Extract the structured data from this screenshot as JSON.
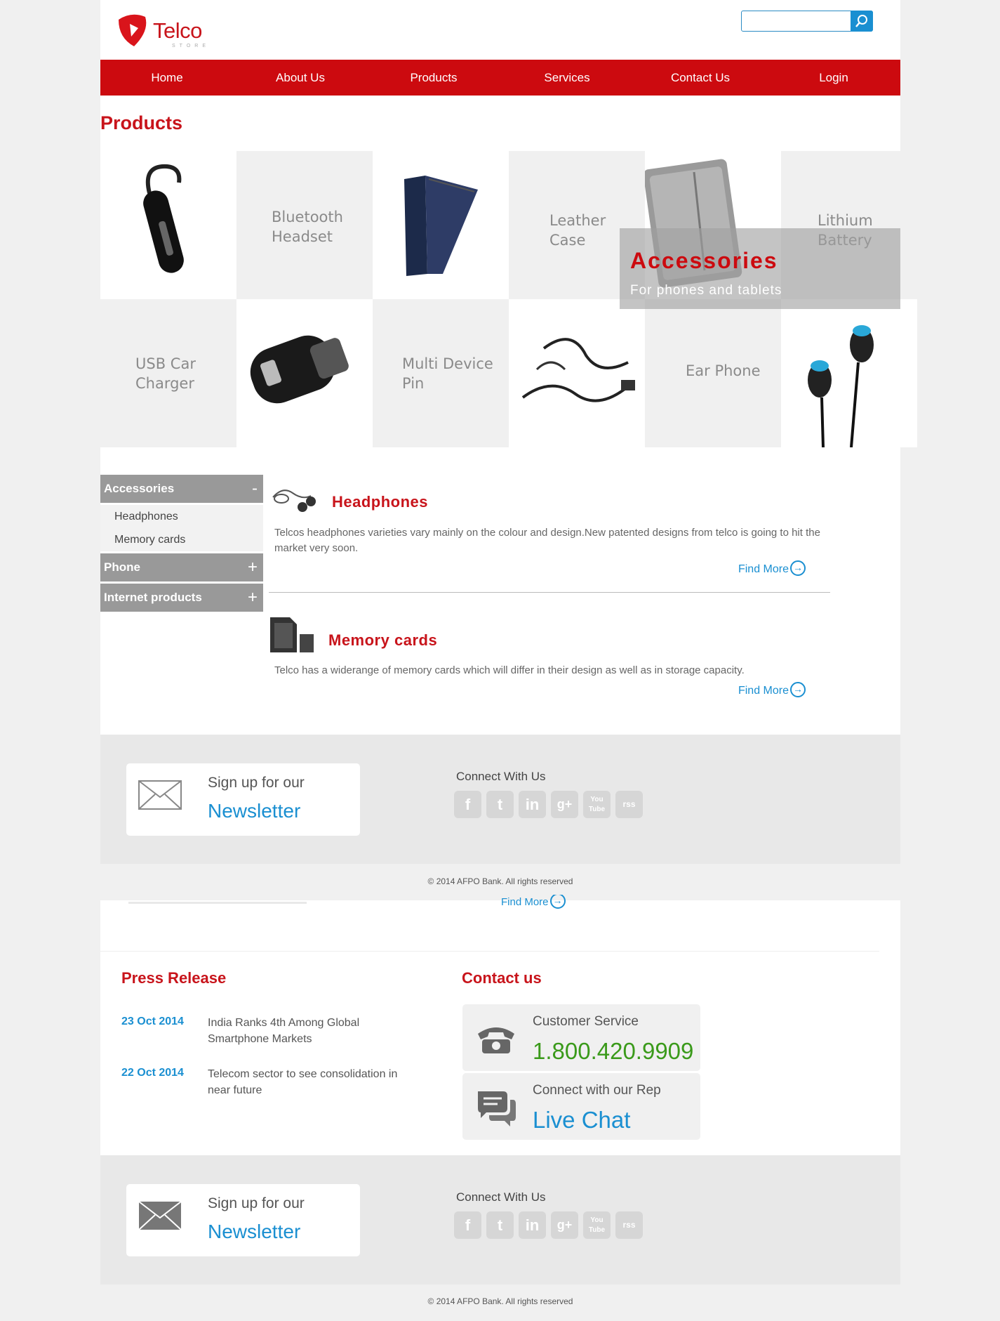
{
  "brand": {
    "name": "Telco",
    "sub": "STORE"
  },
  "search": {
    "placeholder": ""
  },
  "nav": [
    "Home",
    "About Us",
    "Products",
    "Services",
    "Contact Us",
    "Login"
  ],
  "products": {
    "title": "Products",
    "tiles": [
      {
        "label": ""
      },
      {
        "label": "Bluetooth\nHeadset"
      },
      {
        "label": ""
      },
      {
        "label": "Leather\nCase"
      },
      {
        "label": ""
      },
      {
        "label": "Lithium\nBattery"
      },
      {
        "label": "USB Car\nCharger"
      },
      {
        "label": ""
      },
      {
        "label": "Multi Device\nPin"
      },
      {
        "label": ""
      },
      {
        "label": "Ear Phone"
      },
      {
        "label": ""
      }
    ],
    "overlay": {
      "title": "Accessories",
      "subtitle": "For phones and tablets"
    }
  },
  "sidebar": {
    "accessories": {
      "label": "Accessories",
      "toggle": "-",
      "items": [
        "Headphones",
        "Memory cards"
      ]
    },
    "phone": {
      "label": "Phone",
      "toggle": "+"
    },
    "internet": {
      "label": "Internet products",
      "toggle": "+"
    }
  },
  "content": {
    "headphones": {
      "title": "Headphones",
      "desc": "Telcos headphones varieties vary mainly on the colour and design.New patented designs from telco is going to hit the market very soon.",
      "link": "Find More"
    },
    "memory": {
      "title": "Memory cards",
      "desc": "Telco has a widerange of memory cards which will differ in their design as well as in storage capacity.",
      "link": "Find More"
    }
  },
  "footer": {
    "newsletter_small": "Sign up for our",
    "newsletter_big": "Newsletter",
    "connect": "Connect With Us",
    "socials": [
      "f",
      "t",
      "in",
      "g+",
      "You Tube",
      "rss"
    ],
    "copyright": "© 2014 AFPO Bank. All rights reserved"
  },
  "ghost": {
    "link": "Find More"
  },
  "press": {
    "title": "Press Release",
    "items": [
      {
        "date": "23 Oct 2014",
        "text": "India Ranks 4th Among Global Smartphone Markets"
      },
      {
        "date": "22 Oct 2014",
        "text": "Telecom sector to see consolidation in near future"
      }
    ]
  },
  "contact": {
    "title": "Contact us",
    "service_label": "Customer Service",
    "phone": "1.800.420.9909",
    "rep_label": "Connect with our Rep",
    "chat": "Live Chat"
  },
  "colors": {
    "brand_red": "#cc0a0f",
    "link_blue": "#1a8fd1",
    "phone_green": "#3a9a1a"
  }
}
